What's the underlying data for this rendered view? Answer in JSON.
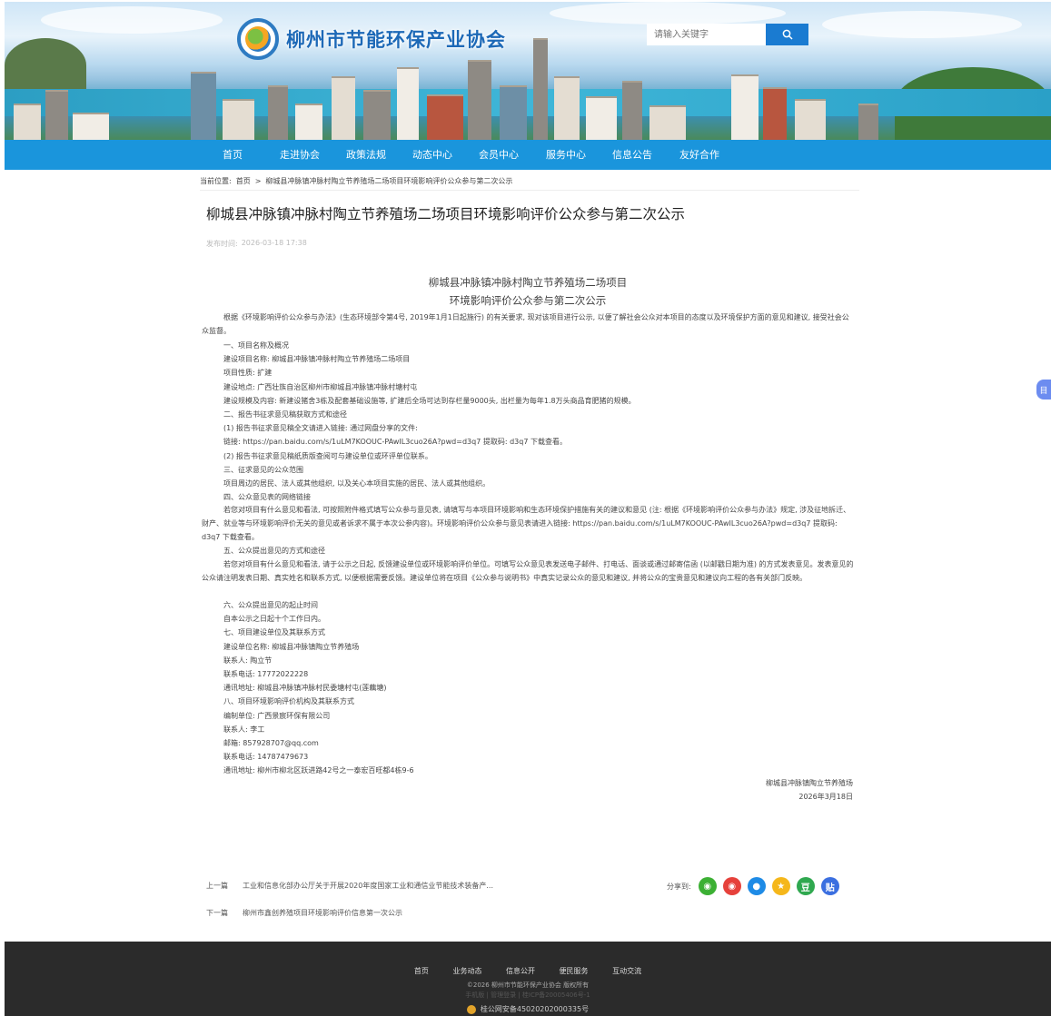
{
  "site": {
    "name": "柳州市节能环保产业协会",
    "search_placeholder": "请输入关键字"
  },
  "nav": [
    "首页",
    "走进协会",
    "政策法规",
    "动态中心",
    "会员中心",
    "服务中心",
    "信息公告",
    "友好合作"
  ],
  "breadcrumb": {
    "label": "当前位置:",
    "home": "首页",
    "sep": ">",
    "current": "柳城县冲脉镇冲脉村陶立节养殖场二场项目环境影响评价公众参与第二次公示"
  },
  "article": {
    "title": "柳城县冲脉镇冲脉村陶立节养殖场二场项目环境影响评价公众参与第二次公示",
    "time_label": "发布时间:",
    "time": "2026-03-18 17:38",
    "doc_title_1": "柳城县冲脉镇冲脉村陶立节养殖场二场项目",
    "doc_title_2": "环境影响评价公众参与第二次公示",
    "intro": "根据《环境影响评价公众参与办法》(生态环境部令第4号, 2019年1月1日起施行) 的有关要求, 现对该项目进行公示, 以便了解社会公众对本项目的态度以及环境保护方面的意见和建议, 接受社会公众监督。",
    "lines1": [
      "一、项目名称及概况",
      "建设项目名称: 柳城县冲脉镇冲脉村陶立节养殖场二场项目",
      "项目性质: 扩建",
      "建设地点: 广西壮族自治区柳州市柳城县冲脉镇冲脉村塘村屯",
      "建设规模及内容: 新建设猪舍3栋及配套基础设施等, 扩建后全场可达到存栏量9000头, 出栏量为每年1.8万头商品育肥猪的规模。",
      "二、报告书征求意见稿获取方式和途径",
      "(1) 报告书征求意见稿全文请进入链接: 通过网盘分享的文件:",
      "链接: https://pan.baidu.com/s/1uLM7KOOUC-PAwIL3cuo26A?pwd=d3q7 提取码: d3q7 下载查看。",
      "(2) 报告书征求意见稿纸质版查阅可与建设单位或环评单位联系。",
      "三、征求意见的公众范围",
      "项目周边的居民、法人或其他组织, 以及关心本项目实施的居民、法人或其他组织。",
      "四、公众意见表的网络链接"
    ],
    "para4": "若您对项目有什么意见和看法, 可按照附件格式填写公众参与意见表, 请填写与本项目环境影响和生态环境保护措施有关的建议和意见 (注: 根据《环境影响评价公众参与办法》规定, 涉及征地拆迁、财产、就业等与环境影响评价无关的意见或者诉求不属于本次公参内容)。环境影响评价公众参与意见表请进入链接: https://pan.baidu.com/s/1uLM7KOOUC-PAwIL3cuo26A?pwd=d3q7 提取码: d3q7 下载查看。",
    "line5": "五、公众提出意见的方式和途径",
    "para5": "若您对项目有什么意见和看法, 请于公示之日起, 反馈建设单位或环境影响评价单位。可填写公众意见表发送电子邮件、打电话、面谈或通过邮寄信函 (以邮戳日期为准) 的方式发表意见。发表意见的公众请注明发表日期、真实姓名和联系方式, 以便根据需要反馈。建设单位将在项目《公众参与说明书》中真实记录公众的意见和建议, 并将公众的宝贵意见和建议向工程的各有关部门反映。",
    "lines2": [
      "六、公众提出意见的起止时间",
      "自本公示之日起十个工作日内。",
      "七、项目建设单位及其联系方式",
      "建设单位名称: 柳城县冲脉镇陶立节养殖场",
      "联系人: 陶立节",
      "联系电话: 17772022228",
      "通讯地址: 柳城县冲脉镇冲脉村民委塘村屯(莲藕塘)",
      "八、项目环境影响评价机构及其联系方式",
      "编制单位: 广西景宸环保有限公司",
      "联系人: 李工",
      "邮箱: 857928707@qq.com",
      "联系电话: 14787479673",
      "通讯地址: 柳州市柳北区跃进路42号之一泰宏百旺都4栋9-6"
    ],
    "sign_org": "柳城县冲脉镇陶立节养殖场",
    "sign_date": "2026年3月18日"
  },
  "prev": {
    "label": "上一篇",
    "title": "工业和信息化部办公厅关于开展2020年度国家工业和通信业节能技术装备产..."
  },
  "next": {
    "label": "下一篇",
    "title": "柳州市鑫创养殖项目环境影响评价信息第一次公示"
  },
  "share": {
    "label": "分享到:",
    "icons": [
      {
        "name": "wechat",
        "color": "#3cb034",
        "glyph": "◉"
      },
      {
        "name": "weibo",
        "color": "#e6413b",
        "glyph": "◉"
      },
      {
        "name": "qq",
        "color": "#1e8be6",
        "glyph": "●"
      },
      {
        "name": "qzone",
        "color": "#f5b71b",
        "glyph": "★"
      },
      {
        "name": "douban",
        "color": "#2fa84f",
        "glyph": "豆"
      },
      {
        "name": "tieba",
        "color": "#3b6fe0",
        "glyph": "贴"
      }
    ]
  },
  "float_tab": "目",
  "footer": {
    "links": [
      "首页",
      "业务动态",
      "信息公开",
      "便民服务",
      "互动交流"
    ],
    "copyright": "©2026 柳州市节能环保产业协会 版权所有",
    "icp": "手机版 | 管理登录 | 桂ICP备20005406号-1",
    "police": "桂公网安备45020202000335号"
  },
  "colors": {
    "nav": "#1a95dc",
    "footer": "#2b2b2b",
    "brand": "#1d69b7"
  }
}
